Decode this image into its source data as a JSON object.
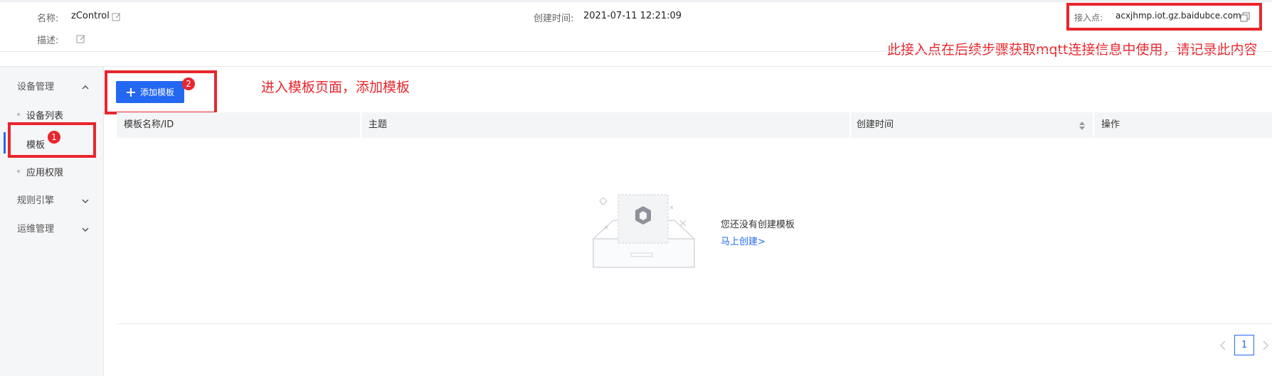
{
  "header": {
    "name_label": "名称:",
    "name_value": "zControl",
    "desc_label": "描述:",
    "created_label": "创建时间:",
    "created_value": "2021-07-11 12:21:09",
    "endpoint_label": "接入点:",
    "endpoint_value": "acxjhmp.iot.gz.baidubce.com"
  },
  "annotations": {
    "endpoint_note": "此接入点在后续步骤获取mqtt连接信息中使用，请记录此内容",
    "add_template_note": "进入模板页面，添加模板",
    "badge_1": "1",
    "badge_2": "2"
  },
  "sidebar": {
    "groups": [
      {
        "label": "设备管理",
        "expanded": true
      },
      {
        "label": "规则引擎",
        "expanded": false
      },
      {
        "label": "运维管理",
        "expanded": false
      }
    ],
    "items": [
      {
        "label": "设备列表",
        "active": false
      },
      {
        "label": "模板",
        "active": true
      },
      {
        "label": "应用权限",
        "active": false
      }
    ]
  },
  "toolbar": {
    "add_template_label": "添加模板"
  },
  "table": {
    "columns": [
      "模板名称/ID",
      "主题",
      "创建时间",
      "操作"
    ]
  },
  "empty_state": {
    "message": "您还没有创建模板",
    "link": "马上创建>"
  },
  "pagination": {
    "current_page": "1"
  },
  "colors": {
    "accent": "#2468f2",
    "annotation_red": "#e8262d"
  }
}
